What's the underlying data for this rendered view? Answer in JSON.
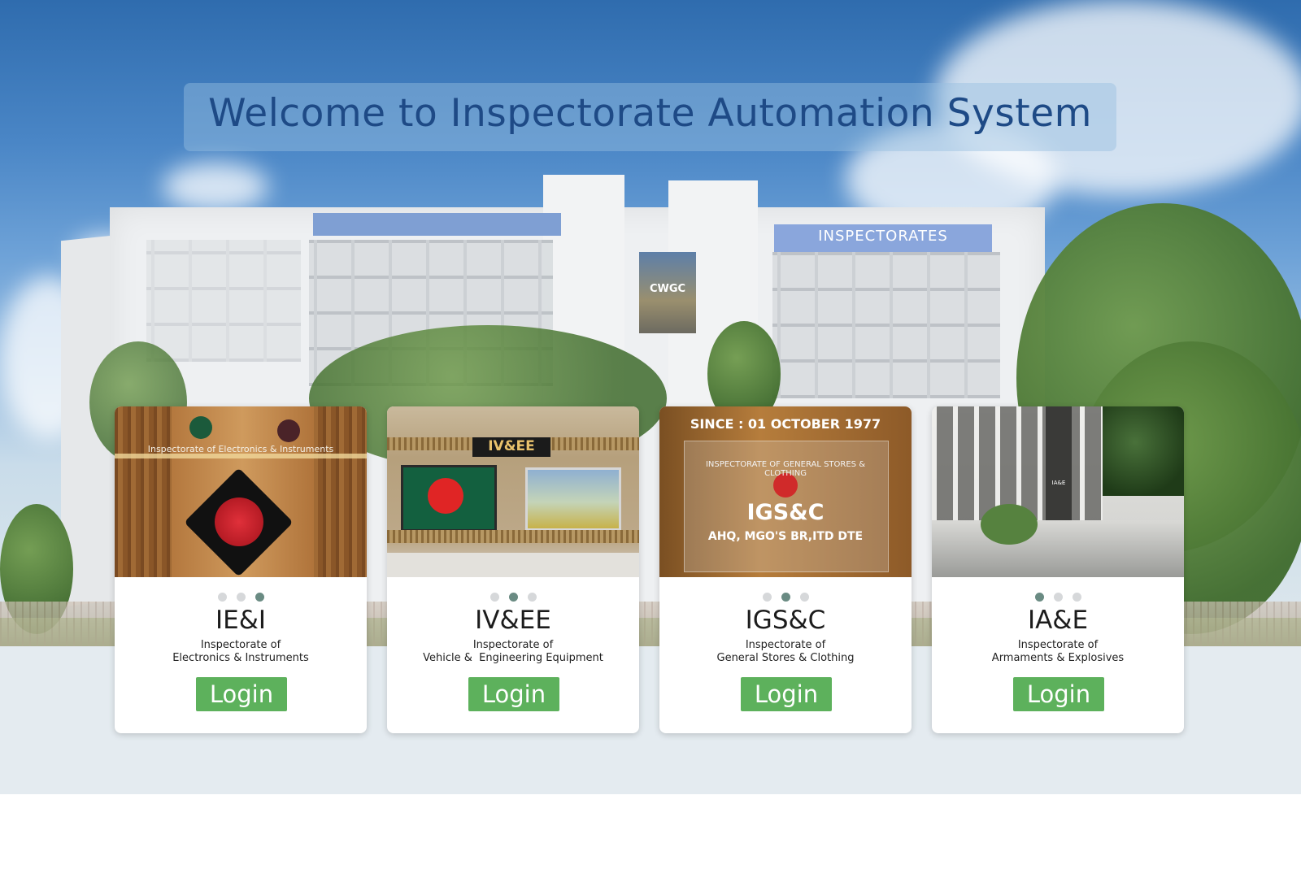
{
  "page": {
    "title": "Welcome to Inspectorate Automation System"
  },
  "building": {
    "sign": "INSPECTORATES",
    "mural": "CWGC"
  },
  "colors": {
    "title": "#1e4a86",
    "login_button": "#5db15c",
    "active_dot": "#6a8b83",
    "inactive_dot": "#d6d8da",
    "lower_band": "#e4ebf0"
  },
  "cards": [
    {
      "abbr": "IE&I",
      "desc_line1": "Inspectorate of",
      "desc_line2": "Electronics & Instruments",
      "login_label": "Login",
      "active_dot": 2,
      "image_text": "Inspectorate of Electronics & Instruments"
    },
    {
      "abbr": "IV&EE",
      "desc_line1": "Inspectorate of",
      "desc_line2": "Vehicle &  Engineering Equipment",
      "login_label": "Login",
      "active_dot": 1,
      "image_text": "IV&EE"
    },
    {
      "abbr": "IGS&C",
      "desc_line1": "Inspectorate of",
      "desc_line2": "General Stores & Clothing",
      "login_label": "Login",
      "active_dot": 1,
      "image_text": {
        "since": "SINCE : 01 OCTOBER 1977",
        "arc": "INSPECTORATE OF GENERAL STORES & CLOTHING",
        "big": "IGS&C",
        "sub": "AHQ, MGO'S BR,ITD DTE"
      }
    },
    {
      "abbr": "IA&E",
      "desc_line1": "Inspectorate of",
      "desc_line2": "Armaments & Explosives",
      "login_label": "Login",
      "active_dot": 0,
      "image_text": "IA&E"
    }
  ]
}
